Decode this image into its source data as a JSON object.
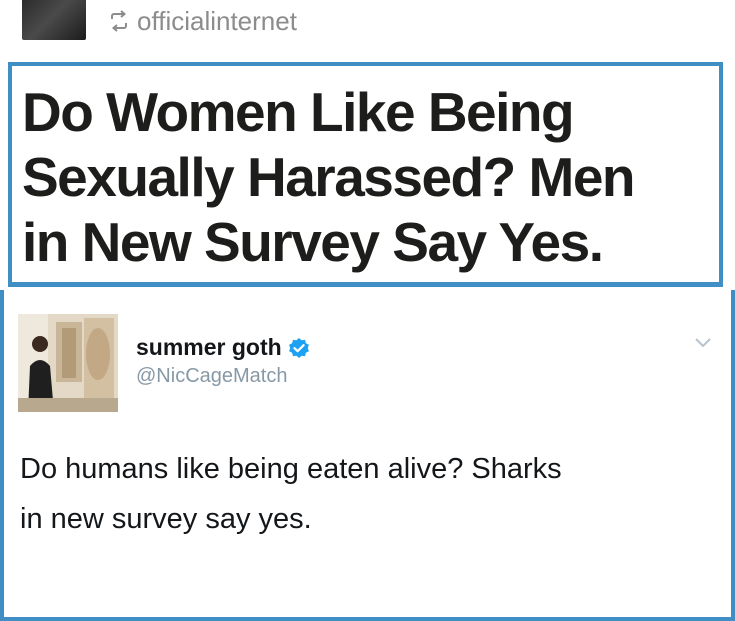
{
  "reblog": {
    "username": "officialinternet",
    "icon": "reblog-icon"
  },
  "article": {
    "headline": "Do Women Like Being\nSexually Harassed? Men\nin New Survey Say Yes."
  },
  "tweet": {
    "display_name": "summer goth",
    "handle": "@NicCageMatch",
    "verified_icon": "verified-badge-icon",
    "text": "Do humans like being eaten alive? Sharks\nin new survey say yes."
  },
  "colors": {
    "border_blue": "#3f8fc4",
    "verified_blue": "#1da1f2",
    "handle_gray": "#8899a6",
    "headline_black": "#1d1d1b"
  }
}
